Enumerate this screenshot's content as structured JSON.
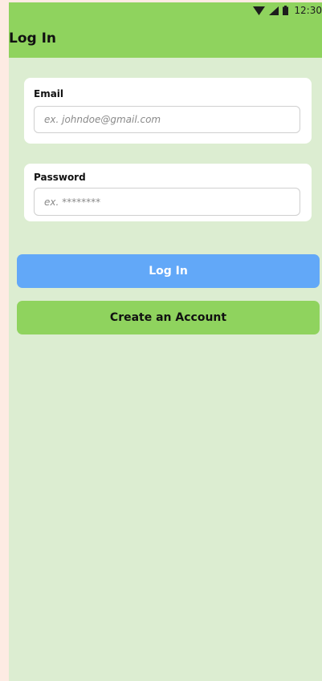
{
  "status_bar": {
    "time": "12:30",
    "icons": [
      "wifi-icon",
      "cellular-signal-icon",
      "battery-icon"
    ]
  },
  "app_bar": {
    "title": "Log In"
  },
  "email": {
    "label": "Email",
    "placeholder": "ex. johndoe@gmail.com",
    "value": ""
  },
  "password": {
    "label": "Password",
    "placeholder": "ex. ********",
    "value": ""
  },
  "buttons": {
    "login_label": "Log In",
    "create_account_label": "Create an Account"
  },
  "colors": {
    "app_bar": "#8fd35e",
    "background": "#dcedd1",
    "outer_background": "#fdebe3",
    "login_button": "#62a8f8",
    "create_button": "#8fd35e"
  }
}
